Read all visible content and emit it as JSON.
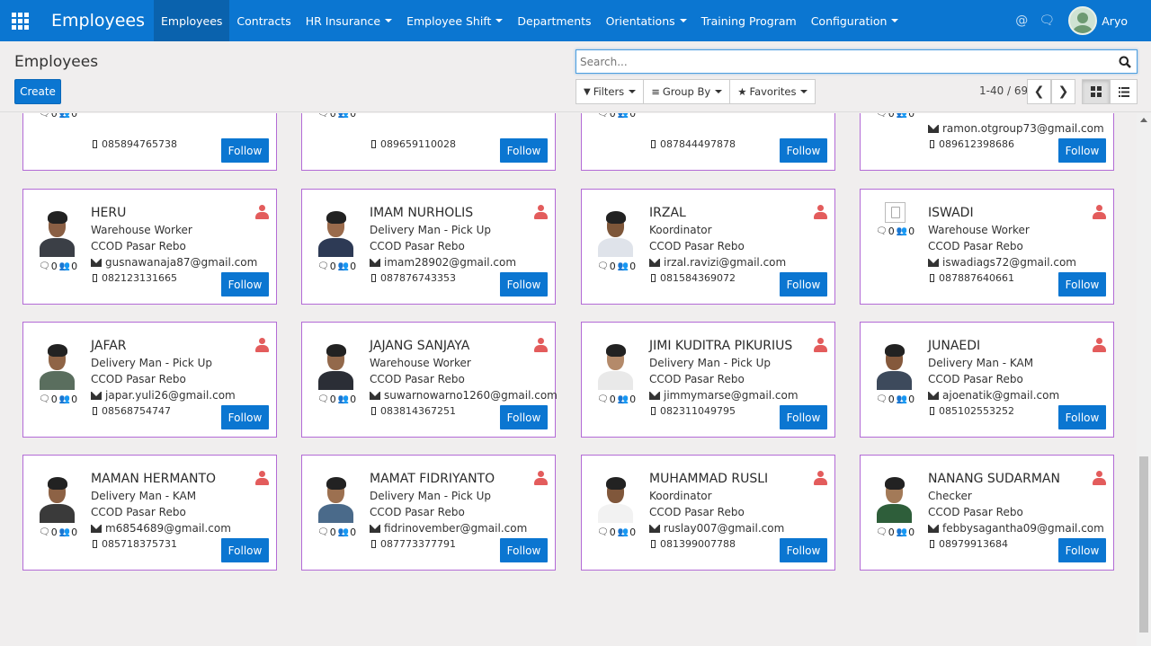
{
  "nav": {
    "app_title": "Employees",
    "menu": [
      {
        "label": "Employees",
        "dropdown": false,
        "active": true
      },
      {
        "label": "Contracts",
        "dropdown": false,
        "active": false
      },
      {
        "label": "HR Insurance",
        "dropdown": true,
        "active": false
      },
      {
        "label": "Employee Shift",
        "dropdown": true,
        "active": false
      },
      {
        "label": "Departments",
        "dropdown": false,
        "active": false
      },
      {
        "label": "Orientations",
        "dropdown": true,
        "active": false
      },
      {
        "label": "Training Program",
        "dropdown": false,
        "active": false
      },
      {
        "label": "Configuration",
        "dropdown": true,
        "active": false
      }
    ],
    "user_name": "Aryo",
    "brand_color": "#0b76d1"
  },
  "control_panel": {
    "breadcrumb": "Employees",
    "create_label": "Create",
    "search_placeholder": "Search...",
    "filters_label": "Filters",
    "groupby_label": "Group By",
    "favorites_label": "Favorites",
    "pager": "1-40 / 69",
    "active_view": "kanban"
  },
  "top_cards": [
    {
      "phone": "085894765738",
      "email": "",
      "count_messages": "0",
      "count_followers": "0",
      "follow_label": "Follow"
    },
    {
      "phone": "089659110028",
      "email": "",
      "count_messages": "0",
      "count_followers": "0",
      "follow_label": "Follow"
    },
    {
      "phone": "087844497878",
      "email": "",
      "count_messages": "0",
      "count_followers": "0",
      "follow_label": "Follow"
    },
    {
      "phone": "089612398686",
      "email": "ramon.otgroup73@gmail.com",
      "count_messages": "0",
      "count_followers": "0",
      "follow_label": "Follow"
    }
  ],
  "employees": [
    {
      "name": "HERU",
      "job": "Warehouse Worker",
      "department": "CCOD Pasar Rebo",
      "email": "gusnawanaja87@gmail.com",
      "phone": "082123131665",
      "messages": "0",
      "followers": "0",
      "follow_label": "Follow",
      "has_photo": true
    },
    {
      "name": "IMAM NURHOLIS",
      "job": "Delivery Man - Pick Up",
      "department": "CCOD Pasar Rebo",
      "email": "imam28902@gmail.com",
      "phone": "087876743353",
      "messages": "0",
      "followers": "0",
      "follow_label": "Follow",
      "has_photo": true
    },
    {
      "name": "IRZAL",
      "job": "Koordinator",
      "department": "CCOD Pasar Rebo",
      "email": "irzal.ravizi@gmail.com",
      "phone": "081584369072",
      "messages": "0",
      "followers": "0",
      "follow_label": "Follow",
      "has_photo": true
    },
    {
      "name": "ISWADI",
      "job": "Warehouse Worker",
      "department": "CCOD Pasar Rebo",
      "email": "iswadiags72@gmail.com",
      "phone": "087887640661",
      "messages": "0",
      "followers": "0",
      "follow_label": "Follow",
      "has_photo": false
    },
    {
      "name": "JAFAR",
      "job": "Delivery Man - Pick Up",
      "department": "CCOD Pasar Rebo",
      "email": "japar.yuli26@gmail.com",
      "phone": "08568754747",
      "messages": "0",
      "followers": "0",
      "follow_label": "Follow",
      "has_photo": true
    },
    {
      "name": "JAJANG SANJAYA",
      "job": "Warehouse Worker",
      "department": "CCOD Pasar Rebo",
      "email": "suwarnowarno1260@gmail.com",
      "phone": "083814367251",
      "messages": "0",
      "followers": "0",
      "follow_label": "Follow",
      "has_photo": true
    },
    {
      "name": "JIMI KUDITRA PIKURIUS",
      "job": "Delivery Man - Pick Up",
      "department": "CCOD Pasar Rebo",
      "email": "jimmymarse@gmail.com",
      "phone": "082311049795",
      "messages": "0",
      "followers": "0",
      "follow_label": "Follow",
      "has_photo": true
    },
    {
      "name": "JUNAEDI",
      "job": "Delivery Man - KAM",
      "department": "CCOD Pasar Rebo",
      "email": "ajoenatik@gmail.com",
      "phone": "085102553252",
      "messages": "0",
      "followers": "0",
      "follow_label": "Follow",
      "has_photo": true
    },
    {
      "name": "MAMAN HERMANTO",
      "job": "Delivery Man - KAM",
      "department": "CCOD Pasar Rebo",
      "email": "m6854689@gmail.com",
      "phone": "085718375731",
      "messages": "0",
      "followers": "0",
      "follow_label": "Follow",
      "has_photo": true
    },
    {
      "name": "MAMAT FIDRIYANTO",
      "job": "Delivery Man - Pick Up",
      "department": "CCOD Pasar Rebo",
      "email": "fidrinovember@gmail.com",
      "phone": "087773377791",
      "messages": "0",
      "followers": "0",
      "follow_label": "Follow",
      "has_photo": true
    },
    {
      "name": "MUHAMMAD RUSLI",
      "job": "Koordinator",
      "department": "CCOD Pasar Rebo",
      "email": "ruslay007@gmail.com",
      "phone": "081399007788",
      "messages": "0",
      "followers": "0",
      "follow_label": "Follow",
      "has_photo": true
    },
    {
      "name": "NANANG SUDARMAN",
      "job": "Checker",
      "department": "CCOD Pasar Rebo",
      "email": "febbysagantha09@gmail.com",
      "phone": "08979913684",
      "messages": "0",
      "followers": "0",
      "follow_label": "Follow",
      "has_photo": true
    }
  ]
}
